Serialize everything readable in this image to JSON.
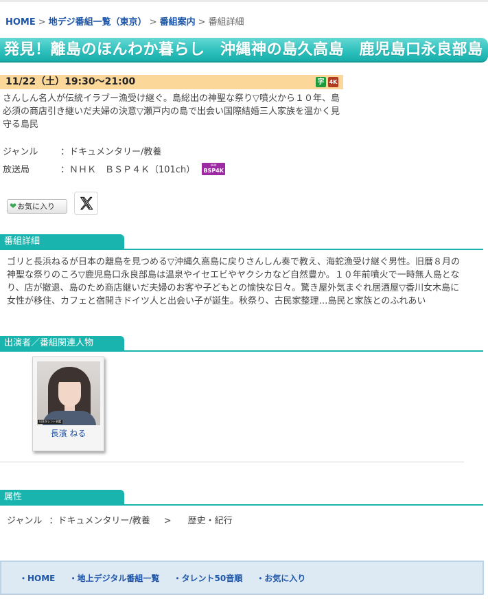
{
  "breadcrumb": {
    "home": "HOME",
    "sep": ">",
    "list": "地デジ番組一覧（東京）",
    "guide": "番組案内",
    "current": "番組詳細"
  },
  "program": {
    "title": "発見！離島のほんわか暮らし　沖縄神の島久高島　鹿児島口永良部島",
    "datetime": "11/22（土）19:30～21:00",
    "badges": {
      "subtitle": "字",
      "uhd": "4K"
    },
    "summary": "さんしん名人が伝統イラブー漁受け継ぐ。島総出の神聖な祭り▽噴火から１０年、島必須の商店引き継いだ夫婦の決意▽瀬戸内の島で出会い国際結婚三人家族を温かく見守る島民",
    "genre_label": "ジャンル",
    "genre_value": "：ドキュメンタリー/教養",
    "station_label": "放送局",
    "station_value": "：ＮＨＫ　ＢＳＰ４Ｋ（101ch）",
    "station_logo_small": "NHK",
    "station_logo": "BSP4K"
  },
  "actions": {
    "favorite_label": "お気に入り",
    "x_share": "X"
  },
  "sections": {
    "detail_title": "番組詳細",
    "detail_text": "ゴリと長浜ねるが日本の離島を見つめる▽沖縄久高島に戻りさんしん奏で教え、海蛇漁受け継ぐ男性。旧暦８月の神聖な祭りのころ▽鹿児島口永良部島は温泉やイセエビやヤクシカなど自然豊か。１０年前噴火で一時無人島となり、店が撤退、島のため商店継いだ夫婦のお客や子どもとの愉快な日々。驚き屋外気まぐれ居酒屋▽香川女木島に女性が移住、カフェと宿開きドイツ人と出会い子が誕生。秋祭り、古民家整理…島民と家族とのふれあい",
    "cast_title": "出演者／番組関連人物",
    "attr_title": "属性"
  },
  "cast": [
    {
      "name": "長濱 ねる",
      "photo_credit": "日本タレント名鑑"
    }
  ],
  "attributes": {
    "genre_label": "ジャンル",
    "genre_value": "：ドキュメンタリー/教養",
    "arrow": ">",
    "subgenre": "歴史・紀行"
  },
  "footer": {
    "links": [
      "・HOME",
      "・地上デジタル番組一覧",
      "・タレント50音順",
      "・お気に入り"
    ]
  },
  "colors": {
    "accent_teal": "#1ab4ae",
    "time_bar": "#fbd89a",
    "link_blue": "#1d55a8",
    "footer_bg": "#dde9f3"
  }
}
